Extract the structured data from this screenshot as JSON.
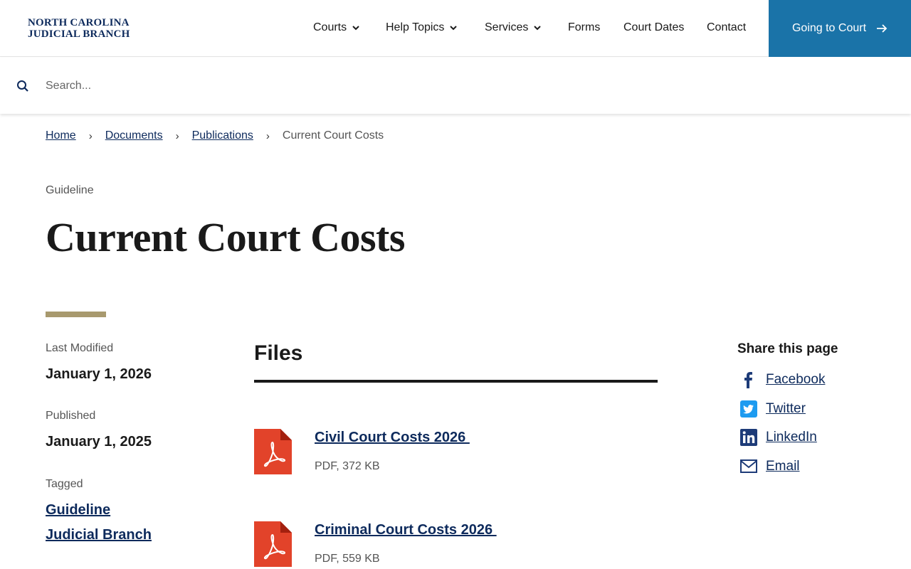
{
  "header": {
    "logo_line1": "NORTH CAROLINA",
    "logo_line2": "JUDICIAL BRANCH",
    "nav": [
      {
        "label": "Courts",
        "dropdown": true
      },
      {
        "label": "Help Topics",
        "dropdown": true
      },
      {
        "label": "Services",
        "dropdown": true
      },
      {
        "label": "Forms",
        "dropdown": false
      },
      {
        "label": "Court Dates",
        "dropdown": false
      },
      {
        "label": "Contact",
        "dropdown": false
      }
    ],
    "cta_label": "Going to Court"
  },
  "search": {
    "placeholder": "Search..."
  },
  "breadcrumb": {
    "items": [
      "Home",
      "Documents",
      "Publications"
    ],
    "current": "Current Court Costs"
  },
  "page": {
    "eyebrow": "Guideline",
    "title": "Current Court Costs"
  },
  "meta": {
    "last_modified_label": "Last Modified",
    "last_modified": "January 1, 2026",
    "published_label": "Published",
    "published": "January 1, 2025",
    "tagged_label": "Tagged",
    "tags": [
      "Guideline",
      "Judicial Branch"
    ]
  },
  "files": {
    "heading": "Files",
    "items": [
      {
        "title": "Civil Court Costs 2026 ",
        "meta": "PDF, 372 KB"
      },
      {
        "title": "Criminal Court Costs 2026 ",
        "meta": "PDF, 559 KB"
      }
    ]
  },
  "share": {
    "heading": "Share this page",
    "items": [
      "Facebook",
      "Twitter",
      "LinkedIn",
      "Email"
    ]
  },
  "colors": {
    "brand_navy": "#0d2a5c",
    "cta_blue": "#1a73a8",
    "accent_gold": "#a8996e",
    "pdf_red": "#e2432a"
  }
}
